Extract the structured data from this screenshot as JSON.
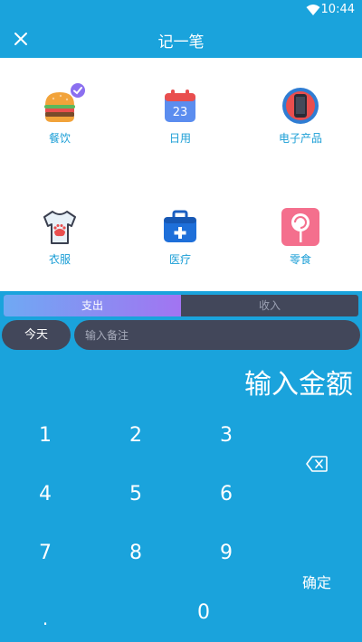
{
  "status": {
    "time": "10:44"
  },
  "appbar": {
    "title": "记一笔"
  },
  "categories": [
    {
      "label": "餐饮",
      "icon": "burger-icon",
      "selected": true
    },
    {
      "label": "日用",
      "icon": "calendar-icon"
    },
    {
      "label": "电子产品",
      "icon": "phone-icon"
    },
    {
      "label": "衣服",
      "icon": "shirt-icon"
    },
    {
      "label": "医疗",
      "icon": "medical-kit-icon"
    },
    {
      "label": "零食",
      "icon": "lollipop-icon"
    }
  ],
  "calendar_day": "23",
  "type_toggle": {
    "expense": "支出",
    "income": "收入",
    "active": "expense"
  },
  "date_button": "今天",
  "note": {
    "placeholder": "输入备注",
    "value": ""
  },
  "amount_placeholder": "输入金额",
  "keypad": {
    "k1": "1",
    "k2": "2",
    "k3": "3",
    "k4": "4",
    "k5": "5",
    "k6": "6",
    "k7": "7",
    "k8": "8",
    "k9": "9",
    "k0": "0",
    "dot": ".",
    "confirm": "确定"
  },
  "colors": {
    "primary": "#1aa3dc",
    "dark": "#42475a",
    "gradient_start": "#6fa9f3",
    "gradient_end": "#a274f2"
  }
}
